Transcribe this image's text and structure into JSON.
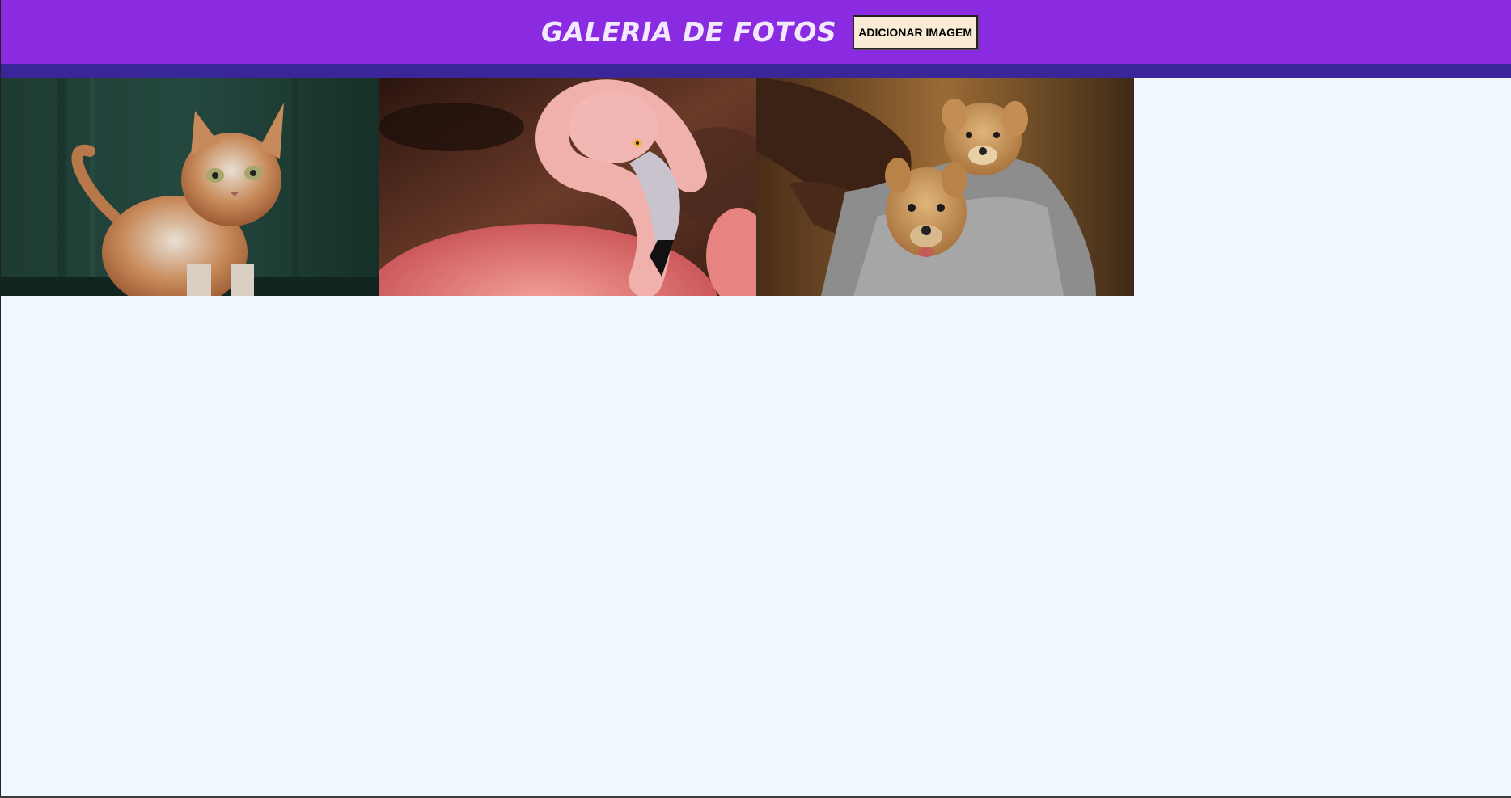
{
  "header": {
    "title": "GALERIA DE FOTOS",
    "add_button_label": "ADICIONAR IMAGEM"
  },
  "colors": {
    "header_bg": "#8a2be2",
    "band": "#3a2699",
    "page_bg": "#eff8fe",
    "button_bg": "#faebd7"
  },
  "gallery": {
    "images": [
      {
        "subject": "cat"
      },
      {
        "subject": "flamingo"
      },
      {
        "subject": "puppies"
      }
    ]
  }
}
